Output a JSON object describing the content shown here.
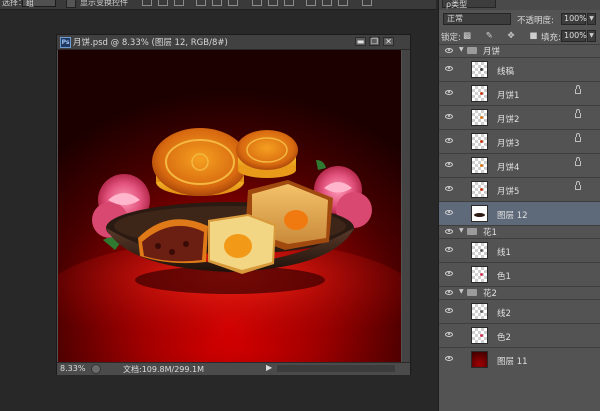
{
  "options_bar": {
    "tool_label": "选择：",
    "select_value": "组",
    "checkbox_label": "显示变换控件"
  },
  "document": {
    "ps_badge": "Ps",
    "title": "月饼.psd @ 8.33% (图层 12, RGB/8#)",
    "zoom": "8.33%",
    "doc_info": "文档:109.8M/299.1M",
    "min_btn": "▬",
    "restore_btn": "❐",
    "close_btn": "✕",
    "status_arrow": "▶"
  },
  "panel": {
    "kind_value": "ρ类型",
    "blend_mode": "正常",
    "opacity_label": "不透明度:",
    "opacity_value": "100%",
    "lock_label": "锁定:",
    "fill_label": "填充:",
    "fill_value": "100%",
    "dropdown_arrow": "▼"
  },
  "layers": [
    {
      "type": "group",
      "name": "月饼"
    },
    {
      "type": "layer",
      "name": "线稿",
      "lock": false,
      "thumb": "transparent",
      "dot": "#444444"
    },
    {
      "type": "layer",
      "name": "月饼1",
      "lock": true,
      "thumb": "transparent",
      "dot": "#c8401a"
    },
    {
      "type": "layer",
      "name": "月饼2",
      "lock": true,
      "thumb": "transparent",
      "dot": "#d87a18"
    },
    {
      "type": "layer",
      "name": "月饼3",
      "lock": true,
      "thumb": "transparent",
      "dot": "#c8401a"
    },
    {
      "type": "layer",
      "name": "月饼4",
      "lock": true,
      "thumb": "transparent",
      "dot": "#d87a18"
    },
    {
      "type": "layer",
      "name": "月饼5",
      "lock": true,
      "thumb": "transparent",
      "dot": "#c8401a"
    },
    {
      "type": "layer",
      "name": "图层 12",
      "lock": false,
      "thumb": "bowl",
      "selected": true
    },
    {
      "type": "group",
      "name": "花1"
    },
    {
      "type": "layer",
      "name": "线1",
      "lock": false,
      "thumb": "transparent",
      "dot": "#666666"
    },
    {
      "type": "layer",
      "name": "色1",
      "lock": false,
      "thumb": "transparent",
      "dot": "#d43a5a"
    },
    {
      "type": "group",
      "name": "花2"
    },
    {
      "type": "layer",
      "name": "线2",
      "lock": false,
      "thumb": "transparent",
      "dot": "#666666"
    },
    {
      "type": "layer",
      "name": "色2",
      "lock": false,
      "thumb": "transparent",
      "dot": "#d43a5a"
    },
    {
      "type": "layer",
      "name": "图层 11",
      "lock": false,
      "thumb": "bg"
    }
  ],
  "colors": {
    "panel_bg": "#535353",
    "selected_layer": "#5e6a7a",
    "workspace": "#282828",
    "canvas_red": "#b00000"
  }
}
